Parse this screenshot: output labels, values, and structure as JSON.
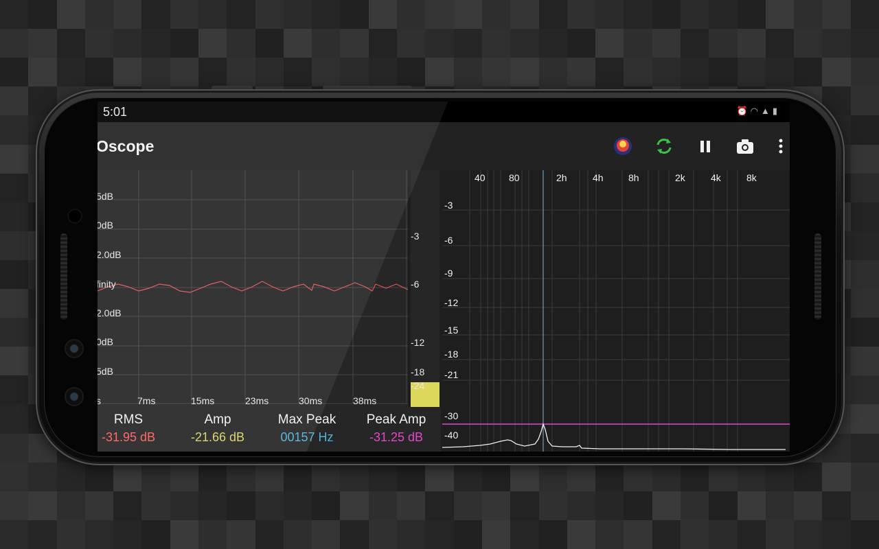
{
  "status_bar": {
    "time": "5:01",
    "icons": [
      "alarm-icon",
      "wifi-icon",
      "signal-icon",
      "battery-icon"
    ]
  },
  "app_bar": {
    "title": "Oscope",
    "actions": [
      {
        "name": "colormap-icon",
        "label": "Color map"
      },
      {
        "name": "refresh-icon",
        "label": "Refresh"
      },
      {
        "name": "pause-icon",
        "label": "Pause"
      },
      {
        "name": "camera-icon",
        "label": "Snapshot"
      },
      {
        "name": "more-icon",
        "label": "More options"
      }
    ]
  },
  "oscilloscope": {
    "y_labels": [
      "5dB",
      "0dB",
      "2.0dB",
      "finity",
      "2.0dB",
      "0dB",
      "5dB"
    ],
    "x_labels": [
      "s",
      "7ms",
      "15ms",
      "23ms",
      "30ms",
      "38ms"
    ],
    "trace_color": "#e05555"
  },
  "level_meter": {
    "labels": [
      "-3",
      "-6",
      "-12",
      "-18",
      "-24"
    ],
    "level_db": -24,
    "fill_color": "#ddd75c"
  },
  "stats": {
    "rms": {
      "label": "RMS",
      "value": "-31.95 dB",
      "color": "#ff5f5f"
    },
    "amp": {
      "label": "Amp",
      "value": "-21.66 dB",
      "color": "#d9d36a"
    },
    "max_peak": {
      "label": "Max Peak",
      "value": "00157 Hz",
      "color": "#4fb3d9"
    },
    "peak_amp": {
      "label": "Peak Amp",
      "value": "-31.25 dB",
      "color": "#e048c8"
    }
  },
  "spectrum": {
    "x_labels": [
      "40",
      "80",
      "2h",
      "4h",
      "8h",
      "2k",
      "4k",
      "8k"
    ],
    "y_labels": [
      "-3",
      "-6",
      "-9",
      "-12",
      "-15",
      "-18",
      "-21",
      "-30",
      "-40"
    ],
    "peak_line_color": "#e048c8",
    "cursor_color": "#7fb8d8"
  }
}
